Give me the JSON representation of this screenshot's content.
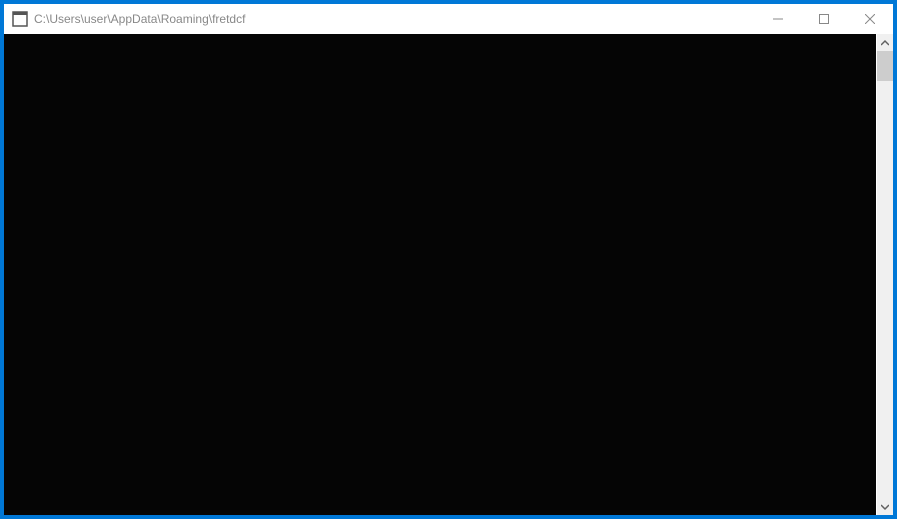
{
  "window": {
    "title": "C:\\Users\\user\\AppData\\Roaming\\fretdcf",
    "content": ""
  },
  "controls": {
    "minimize": "Minimize",
    "maximize": "Maximize",
    "close": "Close"
  }
}
